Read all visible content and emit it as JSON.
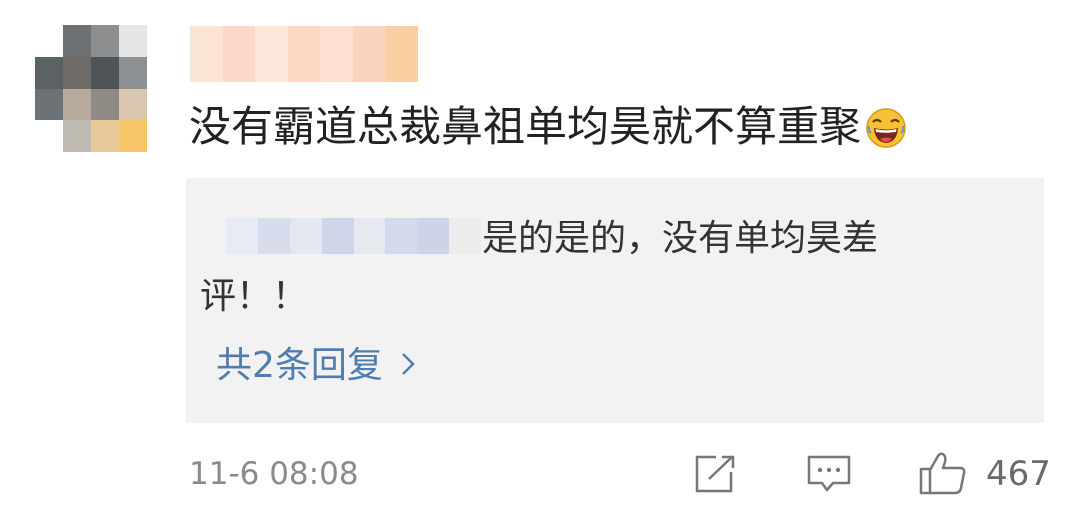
{
  "comment": {
    "text": "没有霸道总裁鼻祖单均昊就不算重聚",
    "emoji_icon": "laughing-emoji-icon",
    "timestamp": "11-6 08:08",
    "like_count": "467"
  },
  "reply": {
    "text": "是的是的，没有单均昊差评！！",
    "total_replies_label": "共2条回复",
    "chevron_icon": "chevron-right-icon"
  },
  "actions": {
    "share_icon": "share-icon",
    "comment_icon": "comment-icon",
    "like_icon": "thumbs-up-icon"
  },
  "colors": {
    "link": "#507daf",
    "reply_background": "#f2f2f2",
    "text": "#222222",
    "meta": "#8a8a8a"
  }
}
